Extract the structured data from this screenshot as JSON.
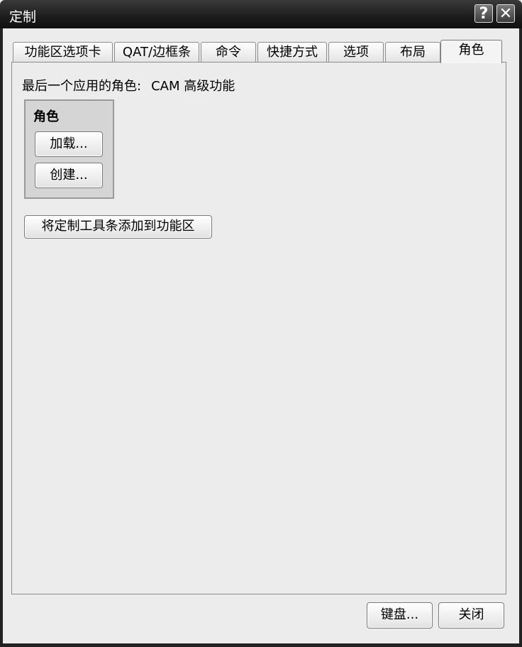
{
  "window": {
    "title": "定制",
    "help_label": "?",
    "close_label": "✕"
  },
  "tabs": [
    {
      "label": "功能区选项卡",
      "active": false
    },
    {
      "label": "QAT/边框条",
      "active": false
    },
    {
      "label": "命令",
      "active": false
    },
    {
      "label": "快捷方式",
      "active": false
    },
    {
      "label": "选项",
      "active": false
    },
    {
      "label": "布局",
      "active": false
    },
    {
      "label": "角色",
      "active": true
    }
  ],
  "roles_page": {
    "last_role_label": "最后一个应用的角色:",
    "last_role_value": "CAM 高级功能",
    "group_title": "角色",
    "load_button": "加载...",
    "create_button": "创建...",
    "add_toolbars_button": "将定制工具条添加到功能区"
  },
  "footer": {
    "keyboard_button": "键盘...",
    "close_button": "关闭"
  },
  "colors": {
    "titlebar": "#1c1c1c",
    "dialog_bg": "#ececec",
    "group_bg": "#d5d5d5"
  }
}
